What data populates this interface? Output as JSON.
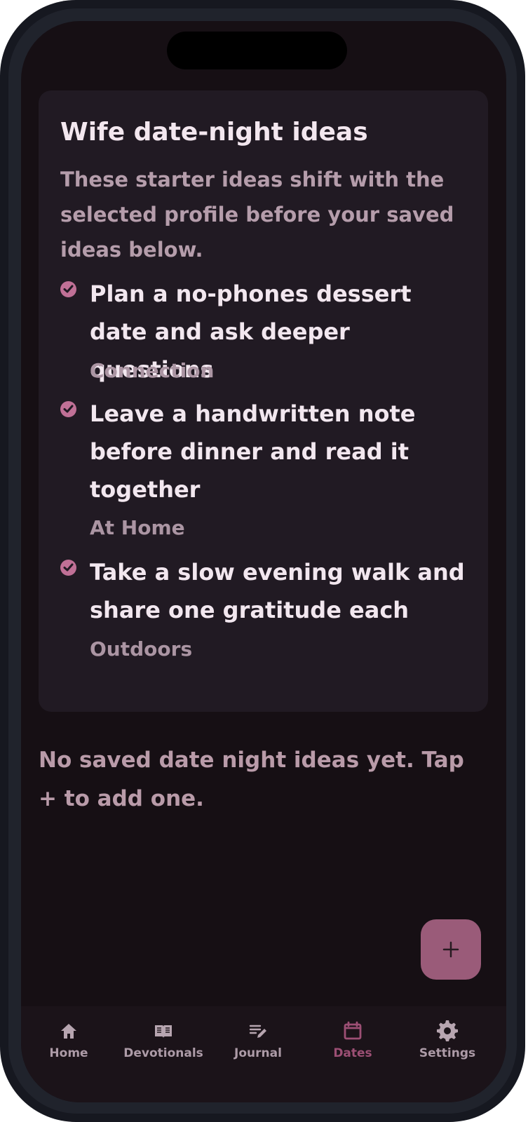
{
  "card": {
    "title": "Wife date-night ideas",
    "subtitle": "These starter ideas shift with the selected profile before your saved ideas below.",
    "ideas": [
      {
        "title": "Plan a no-phones dessert date and ask deeper questions",
        "category": "Connection",
        "icon": "check-circle-icon"
      },
      {
        "title": "Leave a handwritten note before dinner and read it together",
        "category": "At Home",
        "icon": "check-circle-icon"
      },
      {
        "title": "Take a slow evening walk and share one gratitude each",
        "category": "Outdoors",
        "icon": "check-circle-icon"
      }
    ]
  },
  "empty_state": {
    "message": "No saved date night ideas yet. Tap + to add one."
  },
  "fab": {
    "icon": "plus-icon"
  },
  "navigation": {
    "items": [
      {
        "label": "Home",
        "icon": "home-icon",
        "selected": false
      },
      {
        "label": "Devotionals",
        "icon": "book-icon",
        "selected": false
      },
      {
        "label": "Journal",
        "icon": "edit-note-icon",
        "selected": false
      },
      {
        "label": "Dates",
        "icon": "calendar-icon",
        "selected": true
      },
      {
        "label": "Settings",
        "icon": "gear-icon",
        "selected": false
      }
    ]
  },
  "colors": {
    "background": "#160f14",
    "card": "#211a23",
    "accent": "#9a5b79",
    "active_nav": "#9c4f74",
    "primary_text": "#f3e7ef",
    "secondary_text": "#b59dab"
  }
}
